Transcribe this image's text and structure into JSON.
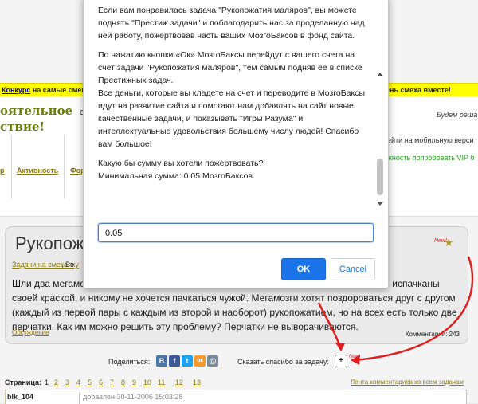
{
  "promo": {
    "link": "Конкурс",
    "left_text": " на самые смешные",
    "right_text": "ень смеха вместе!"
  },
  "header": {
    "logo_line1": "оятельное",
    "logo_line2": "ствие!",
    "center_fragment": "с",
    "right_line1": "Будем реша",
    "right_line2": "рейти на мобильную верси",
    "right_line3": "ожность попробовать VIP б"
  },
  "nav": {
    "items": [
      "р",
      "Активность",
      "Форум"
    ]
  },
  "task": {
    "title": "Рукопожа",
    "new_label": "New!",
    "category_link": "Задачи на смекалку",
    "category_rest": ", Ве",
    "text": "Шли два мегамозга с одинаковыми стаканами синей краски и два мегамозга с одинаковыми стаканами бритой краской, и никому не хочется пачкаться чужой. Мегамозги хотят поздороваться друг с другом (каждый из первой пары с каждым из второй и наоборот) рукопожатием, но на всех есть только две перчатки. Как им можно решить эту проблему? Перчатки не выворачиваются.",
    "text_line1_start": "Шли два мегамоз",
    "text_line1_end": "испачканы",
    "text_line2": "своей краской, и никому не хочется пачкаться чужой. Мегамозги хотят поздороваться друг с другом",
    "text_line3": "(каждый из первой пары с каждым из второй и наоборот) рукопожатием, но на всех есть только две",
    "text_line4": "перчатки. Как им можно решить эту проблему? Перчатки не выворачиваются.",
    "discussion_link": "Обсуждение",
    "comments_label": "Комментарии: 243"
  },
  "share": {
    "label": "Поделиться:",
    "icons": [
      {
        "name": "vk-icon",
        "glyph": "В",
        "color": "#4a76a8"
      },
      {
        "name": "facebook-icon",
        "glyph": "f",
        "color": "#3b5998"
      },
      {
        "name": "twitter-icon",
        "glyph": "t",
        "color": "#1da1f2"
      },
      {
        "name": "odnoklassniki-icon",
        "glyph": "ок",
        "color": "#f59a2b"
      },
      {
        "name": "mailru-icon",
        "glyph": "@",
        "color": "#7a8a9a"
      }
    ],
    "thanks_label": "Сказать спасибо за задачу:",
    "plus_glyph": "+",
    "new_label": "New!"
  },
  "pagination": {
    "label": "Страница:",
    "current": "1",
    "pages": [
      "2",
      "3",
      "4",
      "5",
      "6",
      "7",
      "8",
      "9",
      "10",
      "11",
      "12",
      "13"
    ],
    "feed_link": "Лента комментариев ко всем задачам"
  },
  "comment": {
    "author": "blk_104",
    "date": "добавлен 30-11-2006 15:03:28"
  },
  "dialog": {
    "paragraph1": "Если вам понравилась задача \"Рукопожатия маляров\", вы можете поднять \"Престиж задачи\" и поблагодарить нас за проделанную над ней работу, пожертвовав часть ваших МозгоБаксов в фонд сайта.",
    "paragraph2": "По нажатию кнопки «Ок» МозгоБаксы перейдут с вашего счета на счет задачи \"Рукопожатия маляров\", тем самым подняв ее в списке Престижных задач.",
    "paragraph3": "Все деньги, которые вы кладете на счет и переводите в МозгоБаксы идут на развитие сайта и помогают нам добавлять на сайт новые качественные задачи, и показывать \"Игры Разума\" и интеллектуальные удовольствия большему числу людей! Спасибо вам большое!",
    "question": "Какую бы сумму вы хотели пожертвовать?",
    "minimum": "Минимальная сумма: 0.05 МозгоБаксов.",
    "input_value": "0.05",
    "ok_label": "OK",
    "cancel_label": "Cancel"
  },
  "colors": {
    "primary_button": "#1a73e8",
    "promo_bg": "#ffff00",
    "accent_link": "#8a7a10",
    "annotation": "#e02020"
  }
}
